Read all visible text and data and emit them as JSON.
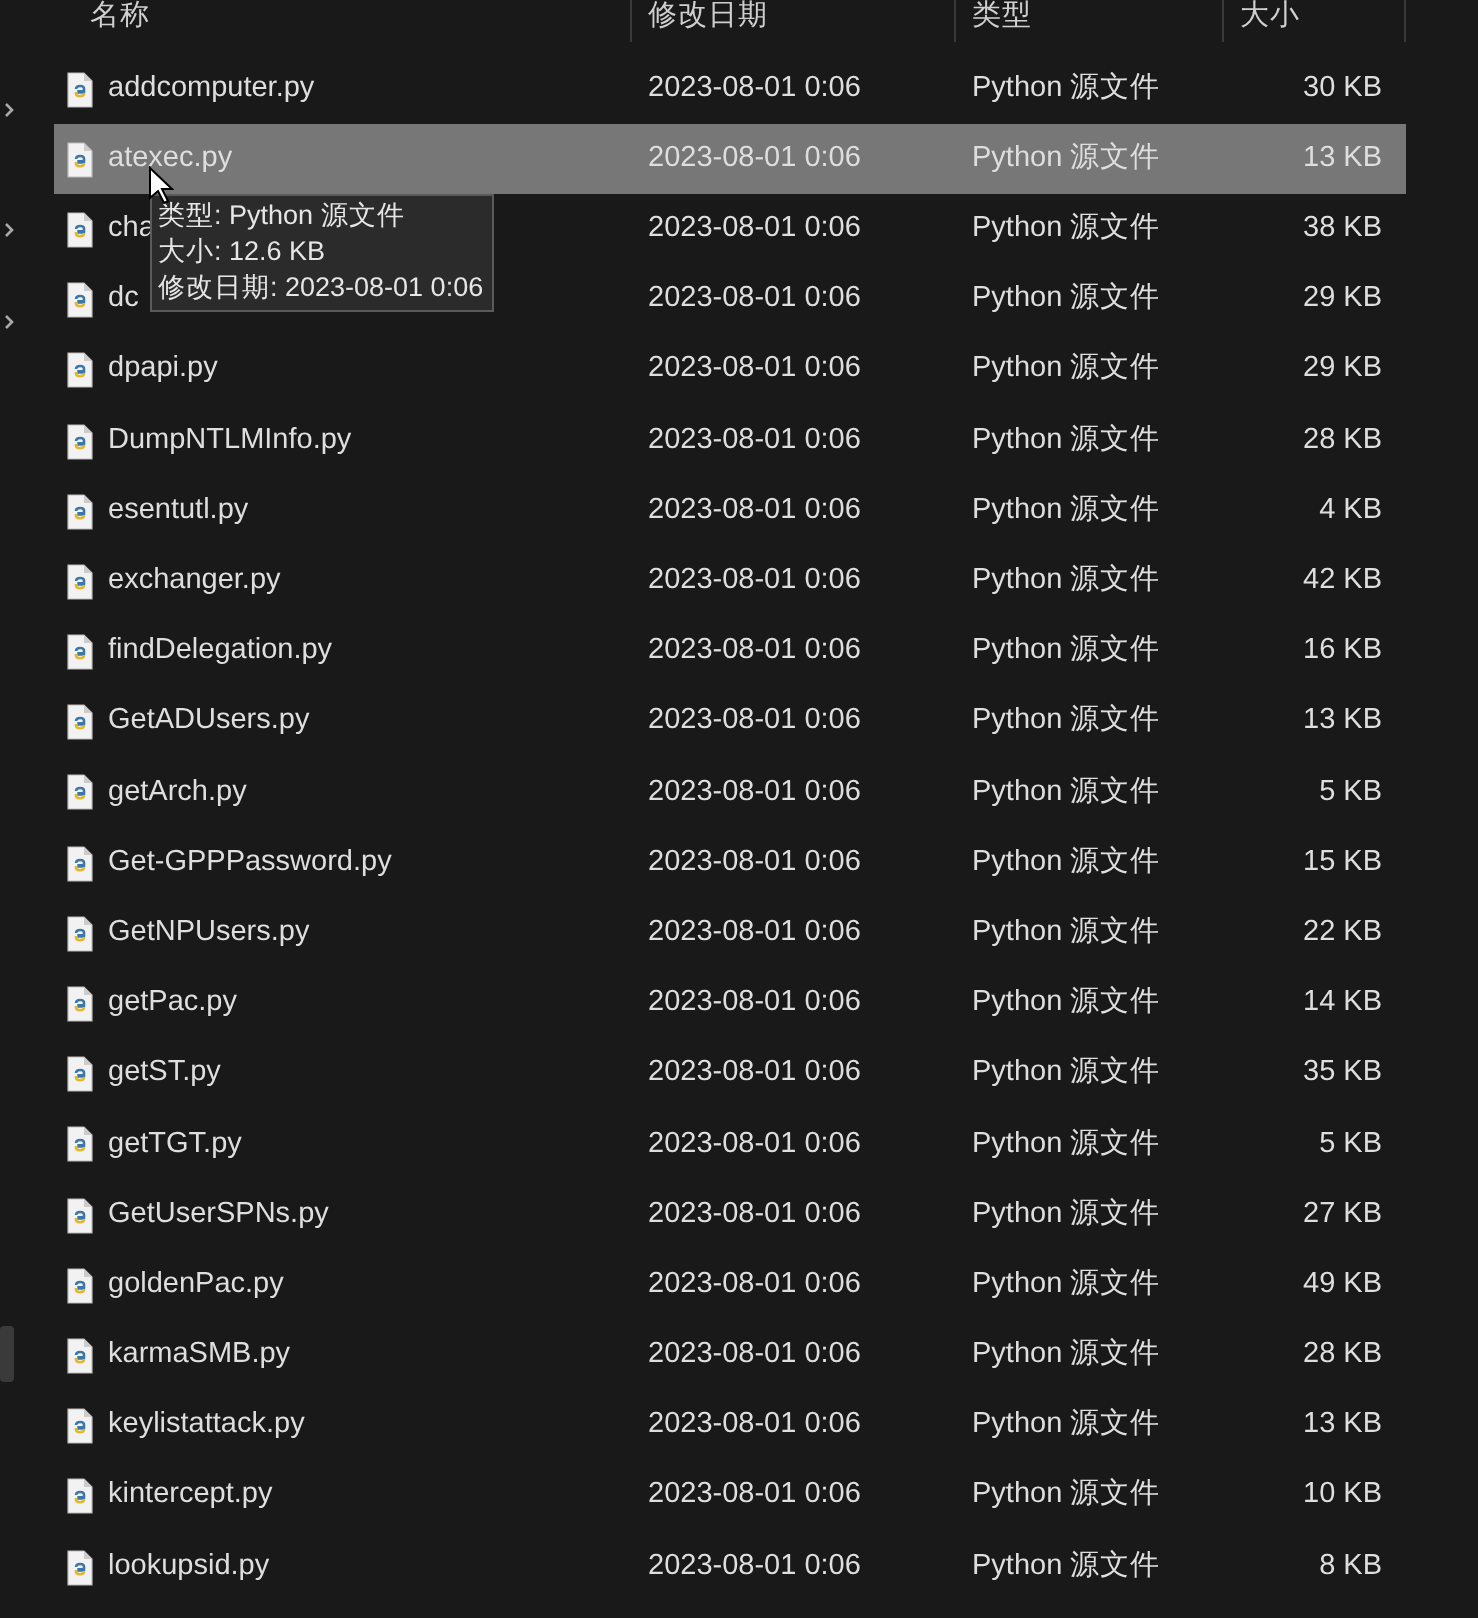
{
  "columns": [
    "名称",
    "修改日期",
    "类型",
    "大小"
  ],
  "rows": [
    {
      "name": "addcomputer.py",
      "modified": "2023-08-01 0:06",
      "type": "Python 源文件",
      "size": "30 KB",
      "selected": false
    },
    {
      "name": "atexec.py",
      "modified": "2023-08-01 0:06",
      "type": "Python 源文件",
      "size": "13 KB",
      "selected": true
    },
    {
      "name": "cha",
      "modified": "2023-08-01 0:06",
      "type": "Python 源文件",
      "size": "38 KB",
      "selected": false
    },
    {
      "name": "dc",
      "modified": "2023-08-01 0:06",
      "type": "Python 源文件",
      "size": "29 KB",
      "selected": false
    },
    {
      "name": "dpapi.py",
      "modified": "2023-08-01 0:06",
      "type": "Python 源文件",
      "size": "29 KB",
      "selected": false
    },
    {
      "name": "DumpNTLMInfo.py",
      "modified": "2023-08-01 0:06",
      "type": "Python 源文件",
      "size": "28 KB",
      "selected": false
    },
    {
      "name": "esentutl.py",
      "modified": "2023-08-01 0:06",
      "type": "Python 源文件",
      "size": "4 KB",
      "selected": false
    },
    {
      "name": "exchanger.py",
      "modified": "2023-08-01 0:06",
      "type": "Python 源文件",
      "size": "42 KB",
      "selected": false
    },
    {
      "name": "findDelegation.py",
      "modified": "2023-08-01 0:06",
      "type": "Python 源文件",
      "size": "16 KB",
      "selected": false
    },
    {
      "name": "GetADUsers.py",
      "modified": "2023-08-01 0:06",
      "type": "Python 源文件",
      "size": "13 KB",
      "selected": false
    },
    {
      "name": "getArch.py",
      "modified": "2023-08-01 0:06",
      "type": "Python 源文件",
      "size": "5 KB",
      "selected": false
    },
    {
      "name": "Get-GPPPassword.py",
      "modified": "2023-08-01 0:06",
      "type": "Python 源文件",
      "size": "15 KB",
      "selected": false
    },
    {
      "name": "GetNPUsers.py",
      "modified": "2023-08-01 0:06",
      "type": "Python 源文件",
      "size": "22 KB",
      "selected": false
    },
    {
      "name": "getPac.py",
      "modified": "2023-08-01 0:06",
      "type": "Python 源文件",
      "size": "14 KB",
      "selected": false
    },
    {
      "name": "getST.py",
      "modified": "2023-08-01 0:06",
      "type": "Python 源文件",
      "size": "35 KB",
      "selected": false
    },
    {
      "name": "getTGT.py",
      "modified": "2023-08-01 0:06",
      "type": "Python 源文件",
      "size": "5 KB",
      "selected": false
    },
    {
      "name": "GetUserSPNs.py",
      "modified": "2023-08-01 0:06",
      "type": "Python 源文件",
      "size": "27 KB",
      "selected": false
    },
    {
      "name": "goldenPac.py",
      "modified": "2023-08-01 0:06",
      "type": "Python 源文件",
      "size": "49 KB",
      "selected": false
    },
    {
      "name": "karmaSMB.py",
      "modified": "2023-08-01 0:06",
      "type": "Python 源文件",
      "size": "28 KB",
      "selected": false
    },
    {
      "name": "keylistattack.py",
      "modified": "2023-08-01 0:06",
      "type": "Python 源文件",
      "size": "13 KB",
      "selected": false
    },
    {
      "name": "kintercept.py",
      "modified": "2023-08-01 0:06",
      "type": "Python 源文件",
      "size": "10 KB",
      "selected": false
    },
    {
      "name": "lookupsid.py",
      "modified": "2023-08-01 0:06",
      "type": "Python 源文件",
      "size": "8 KB",
      "selected": false
    }
  ],
  "tooltip": {
    "lines": [
      "类型: Python 源文件",
      "大小: 12.6 KB",
      "修改日期: 2023-08-01 0:06"
    ]
  }
}
